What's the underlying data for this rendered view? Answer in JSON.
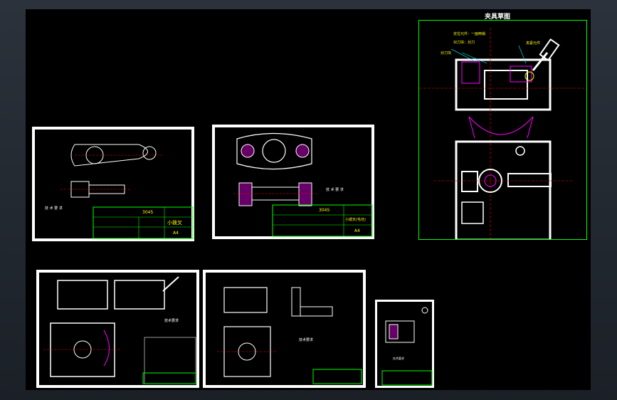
{
  "window": {
    "background": "#212830",
    "canvas_color": "#000000"
  },
  "fixture_sketch": {
    "title": "夹具草图",
    "callout_1": "定位元件：一面两销",
    "callout_2": "对刀块",
    "callout_3": "对刀块：对刀",
    "callout_4": "夹紧元件",
    "border_color": "#00ff00"
  },
  "sheet_part": {
    "part_no": "3045",
    "part_name": "小拨叉",
    "scale": "A4",
    "notes_title": "技 术 要 求"
  },
  "sheet_blank": {
    "part_no": "3045",
    "part_name": "小拨叉(毛坯)",
    "scale": "A4",
    "notes_title": "技 术 要 求"
  },
  "sheet_assembly": {
    "notes_title": "技术要求"
  },
  "sheet_detail": {
    "notes_title": "技术要求"
  },
  "sheet_process": {
    "notes_title": "技术要求"
  },
  "icons": [
    "cad-canvas",
    "drawing-sheet"
  ]
}
